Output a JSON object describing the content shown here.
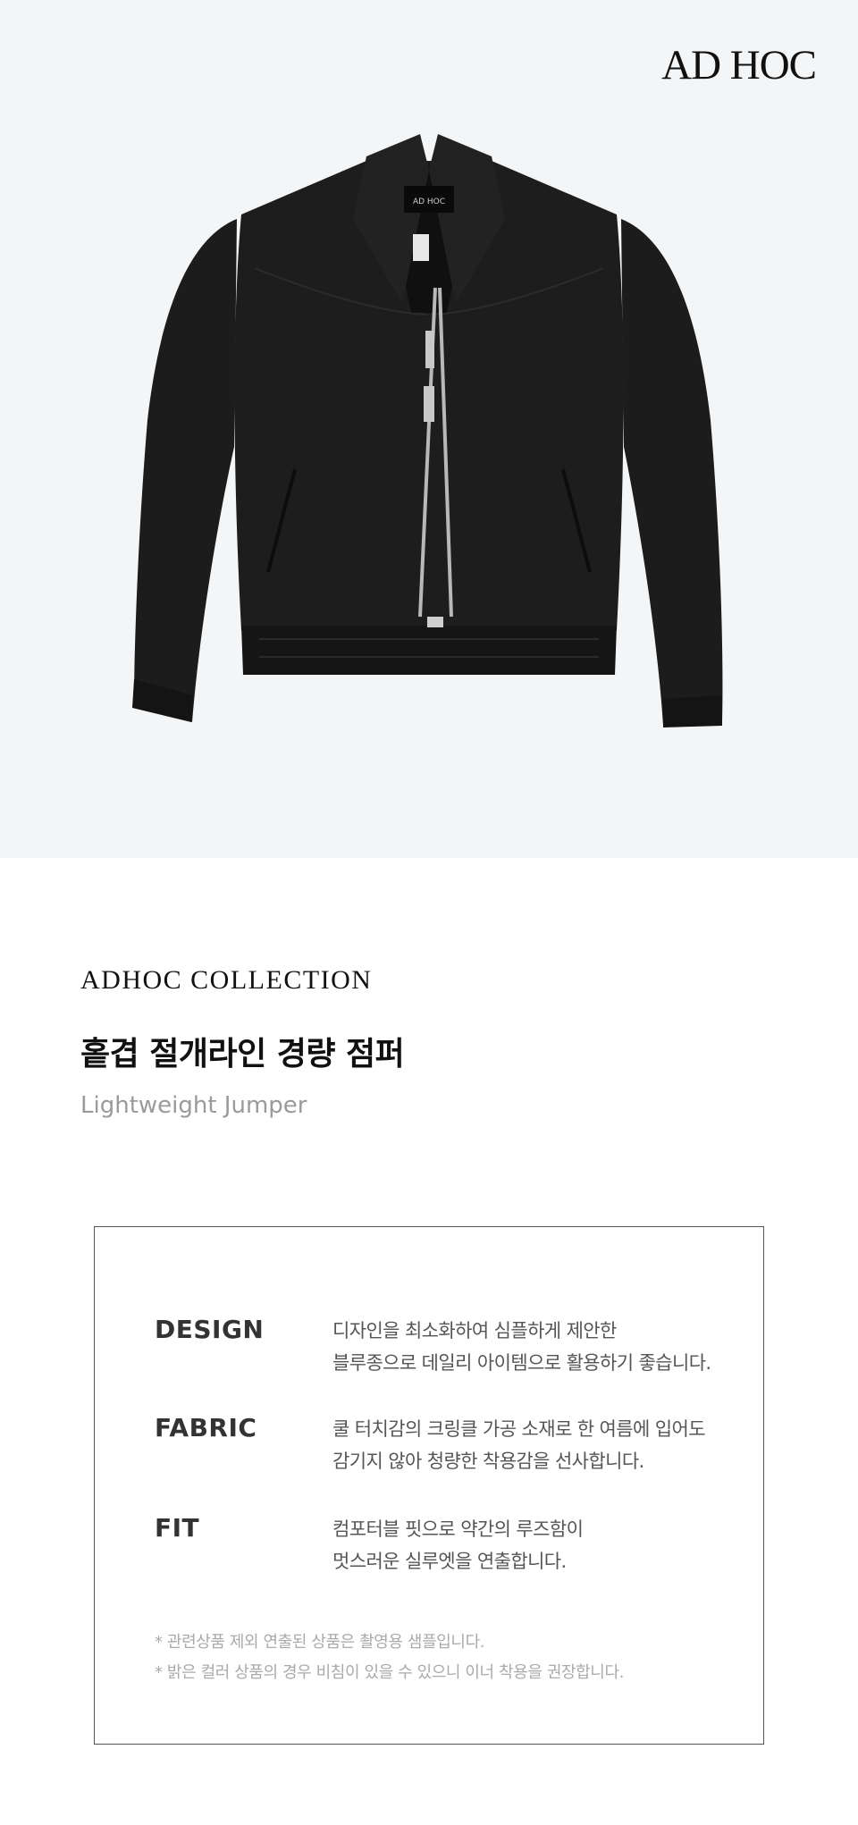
{
  "brand": {
    "logo_text": "AD HOC",
    "label_text": "AD HOC"
  },
  "hero": {
    "background": "#f4f5f7",
    "jacket_color": "#1a1a1a"
  },
  "product": {
    "collection": "ADHOC COLLECTION",
    "title_ko": "홑겹 절개라인 경량 점퍼",
    "title_en": "Lightweight Jumper"
  },
  "specs": [
    {
      "label": "DESIGN",
      "lines": [
        "디자인을 최소화하여 심플하게 제안한",
        "블루종으로 데일리 아이템으로 활용하기 좋습니다."
      ]
    },
    {
      "label": "FABRIC",
      "lines": [
        "쿨 터치감의 크링클 가공 소재로 한 여름에 입어도",
        "감기지 않아 청량한 착용감을 선사합니다."
      ]
    },
    {
      "label": "FIT",
      "lines": [
        "컴포터블 핏으로 약간의 루즈함이",
        "멋스러운 실루엣을 연출합니다."
      ]
    }
  ],
  "notes": [
    "* 관련상품 제외 연출된 상품은 촬영용 샘플입니다.",
    "* 밝은 컬러 상품의 경우 비침이 있을 수 있으니 이너 착용을 권장합니다."
  ]
}
